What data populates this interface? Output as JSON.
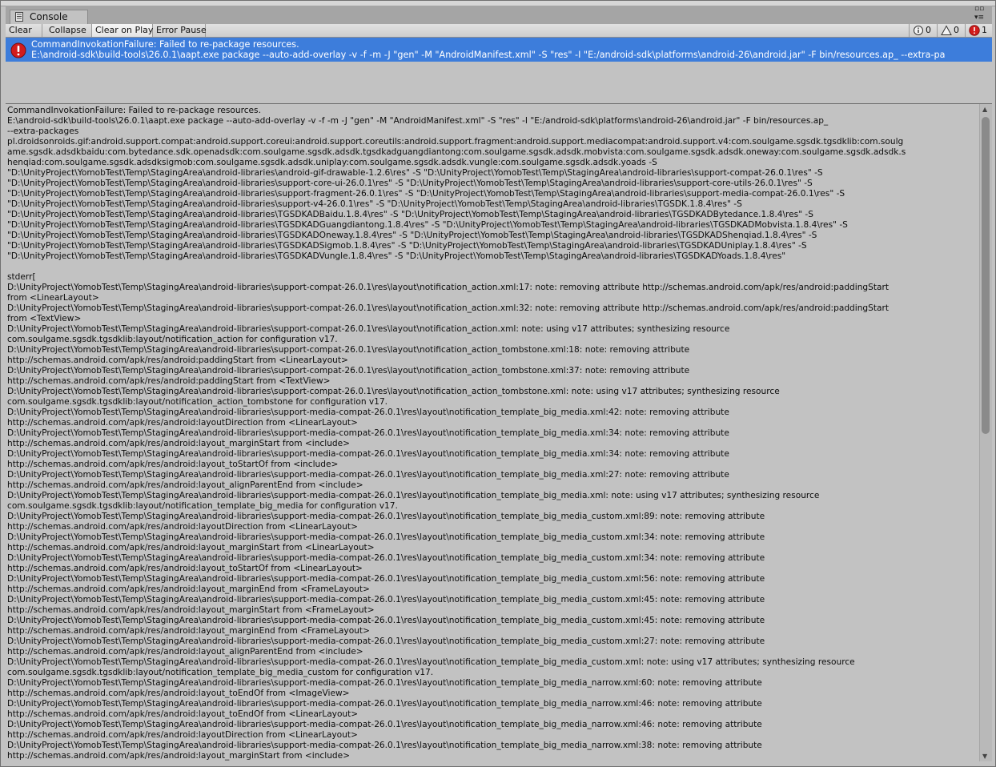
{
  "window": {
    "tab_title": "Console",
    "window_buttons": [
      "▫▫",
      "▾≡"
    ]
  },
  "toolbar": {
    "clear_label": "Clear",
    "collapse_label": "Collapse",
    "clear_on_play_label": "Clear on Play",
    "error_pause_label": "Error Pause",
    "info_count": "0",
    "warning_count": "0",
    "error_count": "1"
  },
  "colors": {
    "selected_row": "#3d7ddb",
    "error_red": "#d21c1c",
    "panel_bg": "#c2c2c2"
  },
  "log_entries": [
    {
      "icon": "error-icon",
      "line1": "CommandInvokationFailure: Failed to re-package resources.",
      "line2": "E:\\android-sdk\\build-tools\\26.0.1\\aapt.exe package --auto-add-overlay -v -f -m -J \"gen\" -M \"AndroidManifest.xml\" -S \"res\" -I \"E:/android-sdk\\platforms\\android-26\\android.jar\" -F bin/resources.ap_ --extra-pa"
    }
  ],
  "detail_lines": [
    "CommandInvokationFailure: Failed to re-package resources.",
    "E:\\android-sdk\\build-tools\\26.0.1\\aapt.exe package --auto-add-overlay -v -f -m -J \"gen\" -M \"AndroidManifest.xml\" -S \"res\" -I \"E:/android-sdk\\platforms\\android-26\\android.jar\" -F bin/resources.ap_",
    "--extra-packages",
    "pl.droidsonroids.gif:android.support.compat:android.support.coreui:android.support.coreutils:android.support.fragment:android.support.mediacompat:android.support.v4:com.soulgame.sgsdk.tgsdklib:com.soulg",
    "ame.sgsdk.adsdkbaidu:com.bytedance.sdk.openadsdk:com.soulgame.sgsdk.adsdk.tgsdkadguangdiantong:com.soulgame.sgsdk.adsdk.mobvista:com.soulgame.sgsdk.adsdk.oneway:com.soulgame.sgsdk.adsdk.s",
    "henqiad:com.soulgame.sgsdk.adsdksigmob:com.soulgame.sgsdk.adsdk.uniplay:com.soulgame.sgsdk.adsdk.vungle:com.soulgame.sgsdk.adsdk.yoads -S",
    "\"D:\\UnityProject\\YomobTest\\Temp\\StagingArea\\android-libraries\\android-gif-drawable-1.2.6\\res\" -S \"D:\\UnityProject\\YomobTest\\Temp\\StagingArea\\android-libraries\\support-compat-26.0.1\\res\" -S",
    "\"D:\\UnityProject\\YomobTest\\Temp\\StagingArea\\android-libraries\\support-core-ui-26.0.1\\res\" -S \"D:\\UnityProject\\YomobTest\\Temp\\StagingArea\\android-libraries\\support-core-utils-26.0.1\\res\" -S",
    "\"D:\\UnityProject\\YomobTest\\Temp\\StagingArea\\android-libraries\\support-fragment-26.0.1\\res\" -S \"D:\\UnityProject\\YomobTest\\Temp\\StagingArea\\android-libraries\\support-media-compat-26.0.1\\res\" -S",
    "\"D:\\UnityProject\\YomobTest\\Temp\\StagingArea\\android-libraries\\support-v4-26.0.1\\res\" -S \"D:\\UnityProject\\YomobTest\\Temp\\StagingArea\\android-libraries\\TGSDK.1.8.4\\res\" -S",
    "\"D:\\UnityProject\\YomobTest\\Temp\\StagingArea\\android-libraries\\TGSDKADBaidu.1.8.4\\res\" -S \"D:\\UnityProject\\YomobTest\\Temp\\StagingArea\\android-libraries\\TGSDKADBytedance.1.8.4\\res\" -S",
    "\"D:\\UnityProject\\YomobTest\\Temp\\StagingArea\\android-libraries\\TGSDKADGuangdiantong.1.8.4\\res\" -S \"D:\\UnityProject\\YomobTest\\Temp\\StagingArea\\android-libraries\\TGSDKADMobvista.1.8.4\\res\" -S",
    "\"D:\\UnityProject\\YomobTest\\Temp\\StagingArea\\android-libraries\\TGSDKADOneway.1.8.4\\res\" -S \"D:\\UnityProject\\YomobTest\\Temp\\StagingArea\\android-libraries\\TGSDKADShenqiad.1.8.4\\res\" -S",
    "\"D:\\UnityProject\\YomobTest\\Temp\\StagingArea\\android-libraries\\TGSDKADSigmob.1.8.4\\res\" -S \"D:\\UnityProject\\YomobTest\\Temp\\StagingArea\\android-libraries\\TGSDKADUniplay.1.8.4\\res\" -S",
    "\"D:\\UnityProject\\YomobTest\\Temp\\StagingArea\\android-libraries\\TGSDKADVungle.1.8.4\\res\" -S \"D:\\UnityProject\\YomobTest\\Temp\\StagingArea\\android-libraries\\TGSDKADYoads.1.8.4\\res\"",
    "",
    "stderr[",
    "D:\\UnityProject\\YomobTest\\Temp\\StagingArea\\android-libraries\\support-compat-26.0.1\\res\\layout\\notification_action.xml:17: note: removing attribute http://schemas.android.com/apk/res/android:paddingStart",
    "from <LinearLayout>",
    "D:\\UnityProject\\YomobTest\\Temp\\StagingArea\\android-libraries\\support-compat-26.0.1\\res\\layout\\notification_action.xml:32: note: removing attribute http://schemas.android.com/apk/res/android:paddingStart",
    "from <TextView>",
    "D:\\UnityProject\\YomobTest\\Temp\\StagingArea\\android-libraries\\support-compat-26.0.1\\res\\layout\\notification_action.xml: note: using v17 attributes; synthesizing resource",
    "com.soulgame.sgsdk.tgsdklib:layout/notification_action for configuration v17.",
    "D:\\UnityProject\\YomobTest\\Temp\\StagingArea\\android-libraries\\support-compat-26.0.1\\res\\layout\\notification_action_tombstone.xml:18: note: removing attribute",
    "http://schemas.android.com/apk/res/android:paddingStart from <LinearLayout>",
    "D:\\UnityProject\\YomobTest\\Temp\\StagingArea\\android-libraries\\support-compat-26.0.1\\res\\layout\\notification_action_tombstone.xml:37: note: removing attribute",
    "http://schemas.android.com/apk/res/android:paddingStart from <TextView>",
    "D:\\UnityProject\\YomobTest\\Temp\\StagingArea\\android-libraries\\support-compat-26.0.1\\res\\layout\\notification_action_tombstone.xml: note: using v17 attributes; synthesizing resource",
    "com.soulgame.sgsdk.tgsdklib:layout/notification_action_tombstone for configuration v17.",
    "D:\\UnityProject\\YomobTest\\Temp\\StagingArea\\android-libraries\\support-media-compat-26.0.1\\res\\layout\\notification_template_big_media.xml:42: note: removing attribute",
    "http://schemas.android.com/apk/res/android:layoutDirection from <LinearLayout>",
    "D:\\UnityProject\\YomobTest\\Temp\\StagingArea\\android-libraries\\support-media-compat-26.0.1\\res\\layout\\notification_template_big_media.xml:34: note: removing attribute",
    "http://schemas.android.com/apk/res/android:layout_marginStart from <include>",
    "D:\\UnityProject\\YomobTest\\Temp\\StagingArea\\android-libraries\\support-media-compat-26.0.1\\res\\layout\\notification_template_big_media.xml:34: note: removing attribute",
    "http://schemas.android.com/apk/res/android:layout_toStartOf from <include>",
    "D:\\UnityProject\\YomobTest\\Temp\\StagingArea\\android-libraries\\support-media-compat-26.0.1\\res\\layout\\notification_template_big_media.xml:27: note: removing attribute",
    "http://schemas.android.com/apk/res/android:layout_alignParentEnd from <include>",
    "D:\\UnityProject\\YomobTest\\Temp\\StagingArea\\android-libraries\\support-media-compat-26.0.1\\res\\layout\\notification_template_big_media.xml: note: using v17 attributes; synthesizing resource",
    "com.soulgame.sgsdk.tgsdklib:layout/notification_template_big_media for configuration v17.",
    "D:\\UnityProject\\YomobTest\\Temp\\StagingArea\\android-libraries\\support-media-compat-26.0.1\\res\\layout\\notification_template_big_media_custom.xml:89: note: removing attribute",
    "http://schemas.android.com/apk/res/android:layoutDirection from <LinearLayout>",
    "D:\\UnityProject\\YomobTest\\Temp\\StagingArea\\android-libraries\\support-media-compat-26.0.1\\res\\layout\\notification_template_big_media_custom.xml:34: note: removing attribute",
    "http://schemas.android.com/apk/res/android:layout_marginStart from <LinearLayout>",
    "D:\\UnityProject\\YomobTest\\Temp\\StagingArea\\android-libraries\\support-media-compat-26.0.1\\res\\layout\\notification_template_big_media_custom.xml:34: note: removing attribute",
    "http://schemas.android.com/apk/res/android:layout_toStartOf from <LinearLayout>",
    "D:\\UnityProject\\YomobTest\\Temp\\StagingArea\\android-libraries\\support-media-compat-26.0.1\\res\\layout\\notification_template_big_media_custom.xml:56: note: removing attribute",
    "http://schemas.android.com/apk/res/android:layout_marginEnd from <FrameLayout>",
    "D:\\UnityProject\\YomobTest\\Temp\\StagingArea\\android-libraries\\support-media-compat-26.0.1\\res\\layout\\notification_template_big_media_custom.xml:45: note: removing attribute",
    "http://schemas.android.com/apk/res/android:layout_marginStart from <FrameLayout>",
    "D:\\UnityProject\\YomobTest\\Temp\\StagingArea\\android-libraries\\support-media-compat-26.0.1\\res\\layout\\notification_template_big_media_custom.xml:45: note: removing attribute",
    "http://schemas.android.com/apk/res/android:layout_marginEnd from <FrameLayout>",
    "D:\\UnityProject\\YomobTest\\Temp\\StagingArea\\android-libraries\\support-media-compat-26.0.1\\res\\layout\\notification_template_big_media_custom.xml:27: note: removing attribute",
    "http://schemas.android.com/apk/res/android:layout_alignParentEnd from <include>",
    "D:\\UnityProject\\YomobTest\\Temp\\StagingArea\\android-libraries\\support-media-compat-26.0.1\\res\\layout\\notification_template_big_media_custom.xml: note: using v17 attributes; synthesizing resource",
    "com.soulgame.sgsdk.tgsdklib:layout/notification_template_big_media_custom for configuration v17.",
    "D:\\UnityProject\\YomobTest\\Temp\\StagingArea\\android-libraries\\support-media-compat-26.0.1\\res\\layout\\notification_template_big_media_narrow.xml:60: note: removing attribute",
    "http://schemas.android.com/apk/res/android:layout_toEndOf from <ImageView>",
    "D:\\UnityProject\\YomobTest\\Temp\\StagingArea\\android-libraries\\support-media-compat-26.0.1\\res\\layout\\notification_template_big_media_narrow.xml:46: note: removing attribute",
    "http://schemas.android.com/apk/res/android:layout_toEndOf from <LinearLayout>",
    "D:\\UnityProject\\YomobTest\\Temp\\StagingArea\\android-libraries\\support-media-compat-26.0.1\\res\\layout\\notification_template_big_media_narrow.xml:46: note: removing attribute",
    "http://schemas.android.com/apk/res/android:layoutDirection from <LinearLayout>",
    "D:\\UnityProject\\YomobTest\\Temp\\StagingArea\\android-libraries\\support-media-compat-26.0.1\\res\\layout\\notification_template_big_media_narrow.xml:38: note: removing attribute",
    "http://schemas.android.com/apk/res/android:layout_marginStart from <include>"
  ]
}
